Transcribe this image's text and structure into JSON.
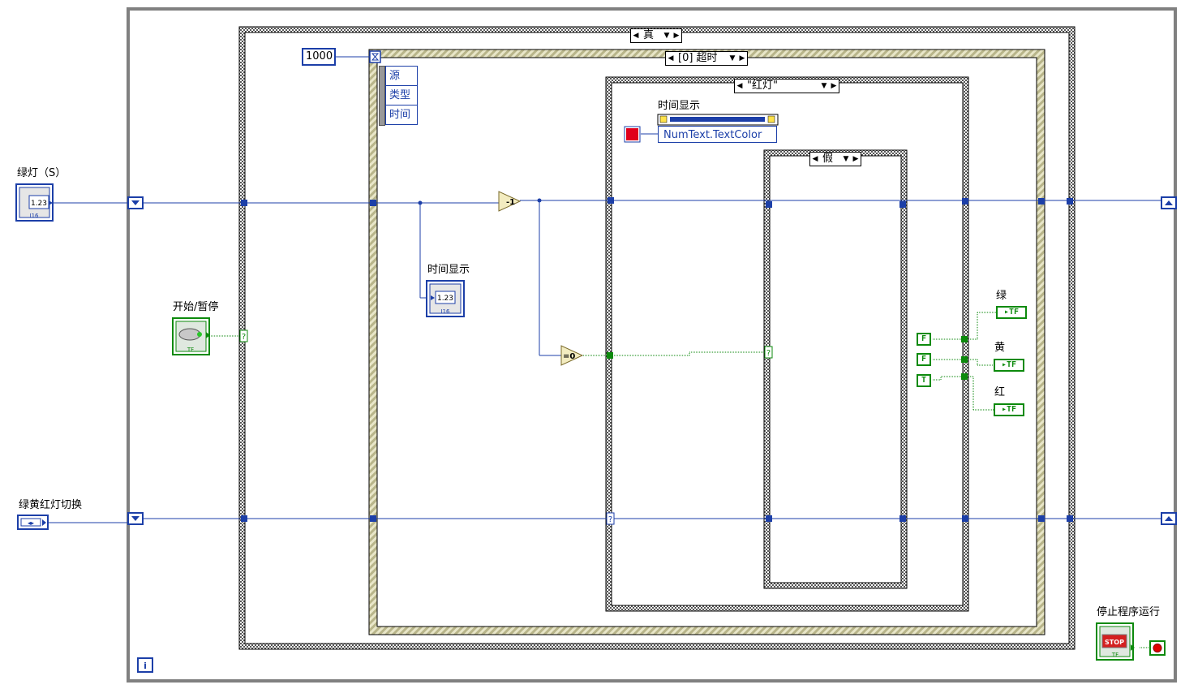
{
  "controls": {
    "green_light_label": "绿灯（S）",
    "green_light_icon": "1.23",
    "start_pause_label": "开始/暂停",
    "switch_label": "绿黄红灯切换",
    "time_display_label": "时间显示",
    "time_display_icon": "1.23",
    "stop_label": "停止程序运行",
    "stop_icon_text": "STOP"
  },
  "constants": {
    "timeout_ms": "1000",
    "bool_green": "F",
    "bool_yellow": "F",
    "bool_red": "T"
  },
  "structures": {
    "outer_case": "真",
    "event_case": "[0] 超时",
    "inner_case": "\"红灯\"",
    "innermost_case": "假"
  },
  "event_data": [
    "源",
    "类型",
    "时间"
  ],
  "property_node": {
    "label": "时间显示",
    "property": "NumText.TextColor"
  },
  "functions": {
    "decrement": "-1",
    "equal_zero": "=0"
  },
  "indicators": {
    "green": "绿",
    "yellow": "黄",
    "red": "红"
  },
  "colors": {
    "wire_numeric": "#1c3fa8",
    "wire_boolean": "#0c8a0c",
    "color_constant": "#e0001b"
  }
}
